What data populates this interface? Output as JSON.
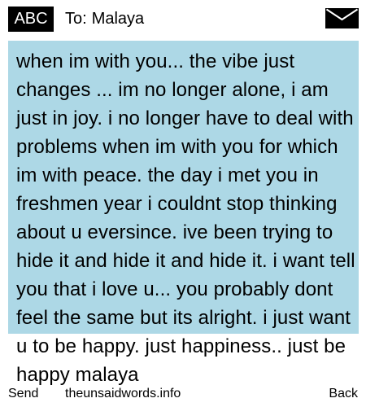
{
  "header": {
    "mode_label": "ABC",
    "to_label": "To:",
    "recipient_name": "Malaya",
    "icon": "envelope-icon"
  },
  "message": {
    "body": "when im with you... the vibe just changes ... im no longer alone, i am just in joy. i no longer have to deal with problems when im with you for which im with peace. the day i met you in freshmen year i couldnt stop thinking about u eversince. ive been trying to hide it and hide it and hide it. i want tell you that i love u... you probably dont feel the same but its alright. i just want u to be happy. just happiness.. just be happy malaya"
  },
  "softkeys": {
    "left": "Send",
    "center": "theunsaidwords.info",
    "right": "Back"
  },
  "colors": {
    "message_background": "#add8e6",
    "badge_background": "#000000"
  }
}
